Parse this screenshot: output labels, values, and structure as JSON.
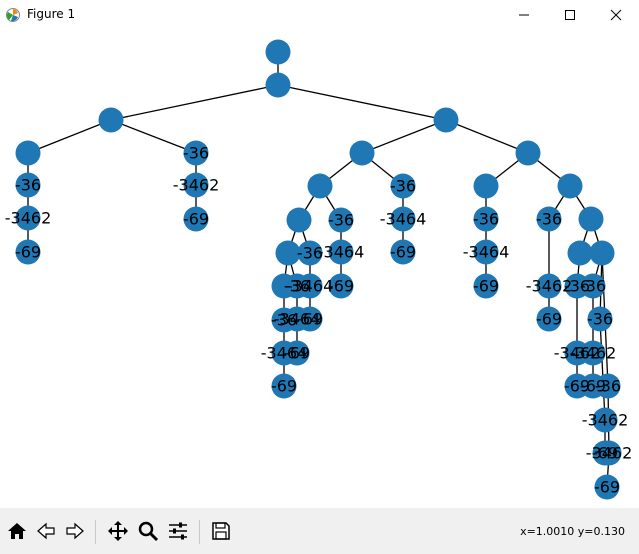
{
  "window": {
    "title": "Figure 1",
    "controls": [
      "minimize",
      "maximize",
      "close"
    ]
  },
  "toolbar": {
    "buttons": [
      "home",
      "back",
      "forward",
      "pan",
      "zoom",
      "configure-subplots",
      "save"
    ],
    "coords": "x=1.0010 y=0.130"
  },
  "tree": {
    "node_color": "#1f77b4",
    "edge_color": "#000000",
    "nodes": [
      {
        "id": "n0",
        "label": ""
      },
      {
        "id": "n1",
        "label": "",
        "parent": "n0"
      },
      {
        "id": "n2",
        "label": "",
        "parent": "n1"
      },
      {
        "id": "n3",
        "label": "",
        "parent": "n1"
      },
      {
        "id": "n4",
        "label": "",
        "parent": "n2"
      },
      {
        "id": "n5",
        "label": "-36",
        "parent": "n2"
      },
      {
        "id": "n6",
        "label": "-36",
        "parent": "n4"
      },
      {
        "id": "n7",
        "label": "-3462",
        "parent": "n6"
      },
      {
        "id": "n8",
        "label": "-69",
        "parent": "n7"
      },
      {
        "id": "n9",
        "label": "-3462",
        "parent": "n5"
      },
      {
        "id": "n10",
        "label": "-69",
        "parent": "n9"
      },
      {
        "id": "n11",
        "label": "",
        "parent": "n3"
      },
      {
        "id": "n12",
        "label": "",
        "parent": "n3"
      },
      {
        "id": "n13",
        "label": "",
        "parent": "n11"
      },
      {
        "id": "n14",
        "label": "-36",
        "parent": "n11"
      },
      {
        "id": "n15",
        "label": "-3464",
        "parent": "n14"
      },
      {
        "id": "n16",
        "label": "-69",
        "parent": "n15"
      },
      {
        "id": "n17",
        "label": "",
        "parent": "n13"
      },
      {
        "id": "n18",
        "label": "-36",
        "parent": "n13"
      },
      {
        "id": "n19",
        "label": "-3464",
        "parent": "n18"
      },
      {
        "id": "n20",
        "label": "-69",
        "parent": "n19"
      },
      {
        "id": "n21",
        "label": "",
        "parent": "n17"
      },
      {
        "id": "n22",
        "label": "-36",
        "parent": "n17"
      },
      {
        "id": "n23",
        "label": "-3464",
        "parent": "n22"
      },
      {
        "id": "n24",
        "label": "-69",
        "parent": "n23"
      },
      {
        "id": "n25",
        "label": "",
        "parent": "n21"
      },
      {
        "id": "n26",
        "label": "-36",
        "parent": "n21"
      },
      {
        "id": "n27",
        "label": "-3464",
        "parent": "n26"
      },
      {
        "id": "n28",
        "label": "-69",
        "parent": "n27"
      },
      {
        "id": "n29",
        "label": "-36",
        "parent": "n25"
      },
      {
        "id": "n30",
        "label": "-3464",
        "parent": "n29"
      },
      {
        "id": "n31",
        "label": "-69",
        "parent": "n30"
      },
      {
        "id": "n32",
        "label": "",
        "parent": "n12"
      },
      {
        "id": "n33",
        "label": "",
        "parent": "n12"
      },
      {
        "id": "n34",
        "label": "-36",
        "parent": "n32"
      },
      {
        "id": "n35",
        "label": "-3464",
        "parent": "n34"
      },
      {
        "id": "n36",
        "label": "-69",
        "parent": "n35"
      },
      {
        "id": "n37",
        "label": "-36",
        "parent": "n33"
      },
      {
        "id": "n38",
        "label": "",
        "parent": "n33"
      },
      {
        "id": "n39",
        "label": "-3462",
        "parent": "n37"
      },
      {
        "id": "n40",
        "label": "-69",
        "parent": "n39"
      },
      {
        "id": "n41",
        "label": "",
        "parent": "n38"
      },
      {
        "id": "n42",
        "label": "",
        "parent": "n38"
      },
      {
        "id": "n43",
        "label": "-36",
        "parent": "n41"
      },
      {
        "id": "n44",
        "label": "-3462",
        "parent": "n43"
      },
      {
        "id": "n45",
        "label": "-69",
        "parent": "n44"
      },
      {
        "id": "n46",
        "label": "-36",
        "parent": "n42"
      },
      {
        "id": "n47",
        "label": "-3462",
        "parent": "n46"
      },
      {
        "id": "n48",
        "label": "-69",
        "parent": "n47"
      },
      {
        "id": "n49",
        "label": "-36",
        "parent": "n42"
      },
      {
        "id": "n50",
        "label": "-3462",
        "parent": "n49"
      },
      {
        "id": "n51",
        "label": "-69",
        "parent": "n50"
      },
      {
        "id": "n52",
        "label": "-36",
        "parent": "n42"
      },
      {
        "id": "n53",
        "label": "-3462",
        "parent": "n52"
      },
      {
        "id": "n54",
        "label": "-69",
        "parent": "n53"
      }
    ]
  }
}
